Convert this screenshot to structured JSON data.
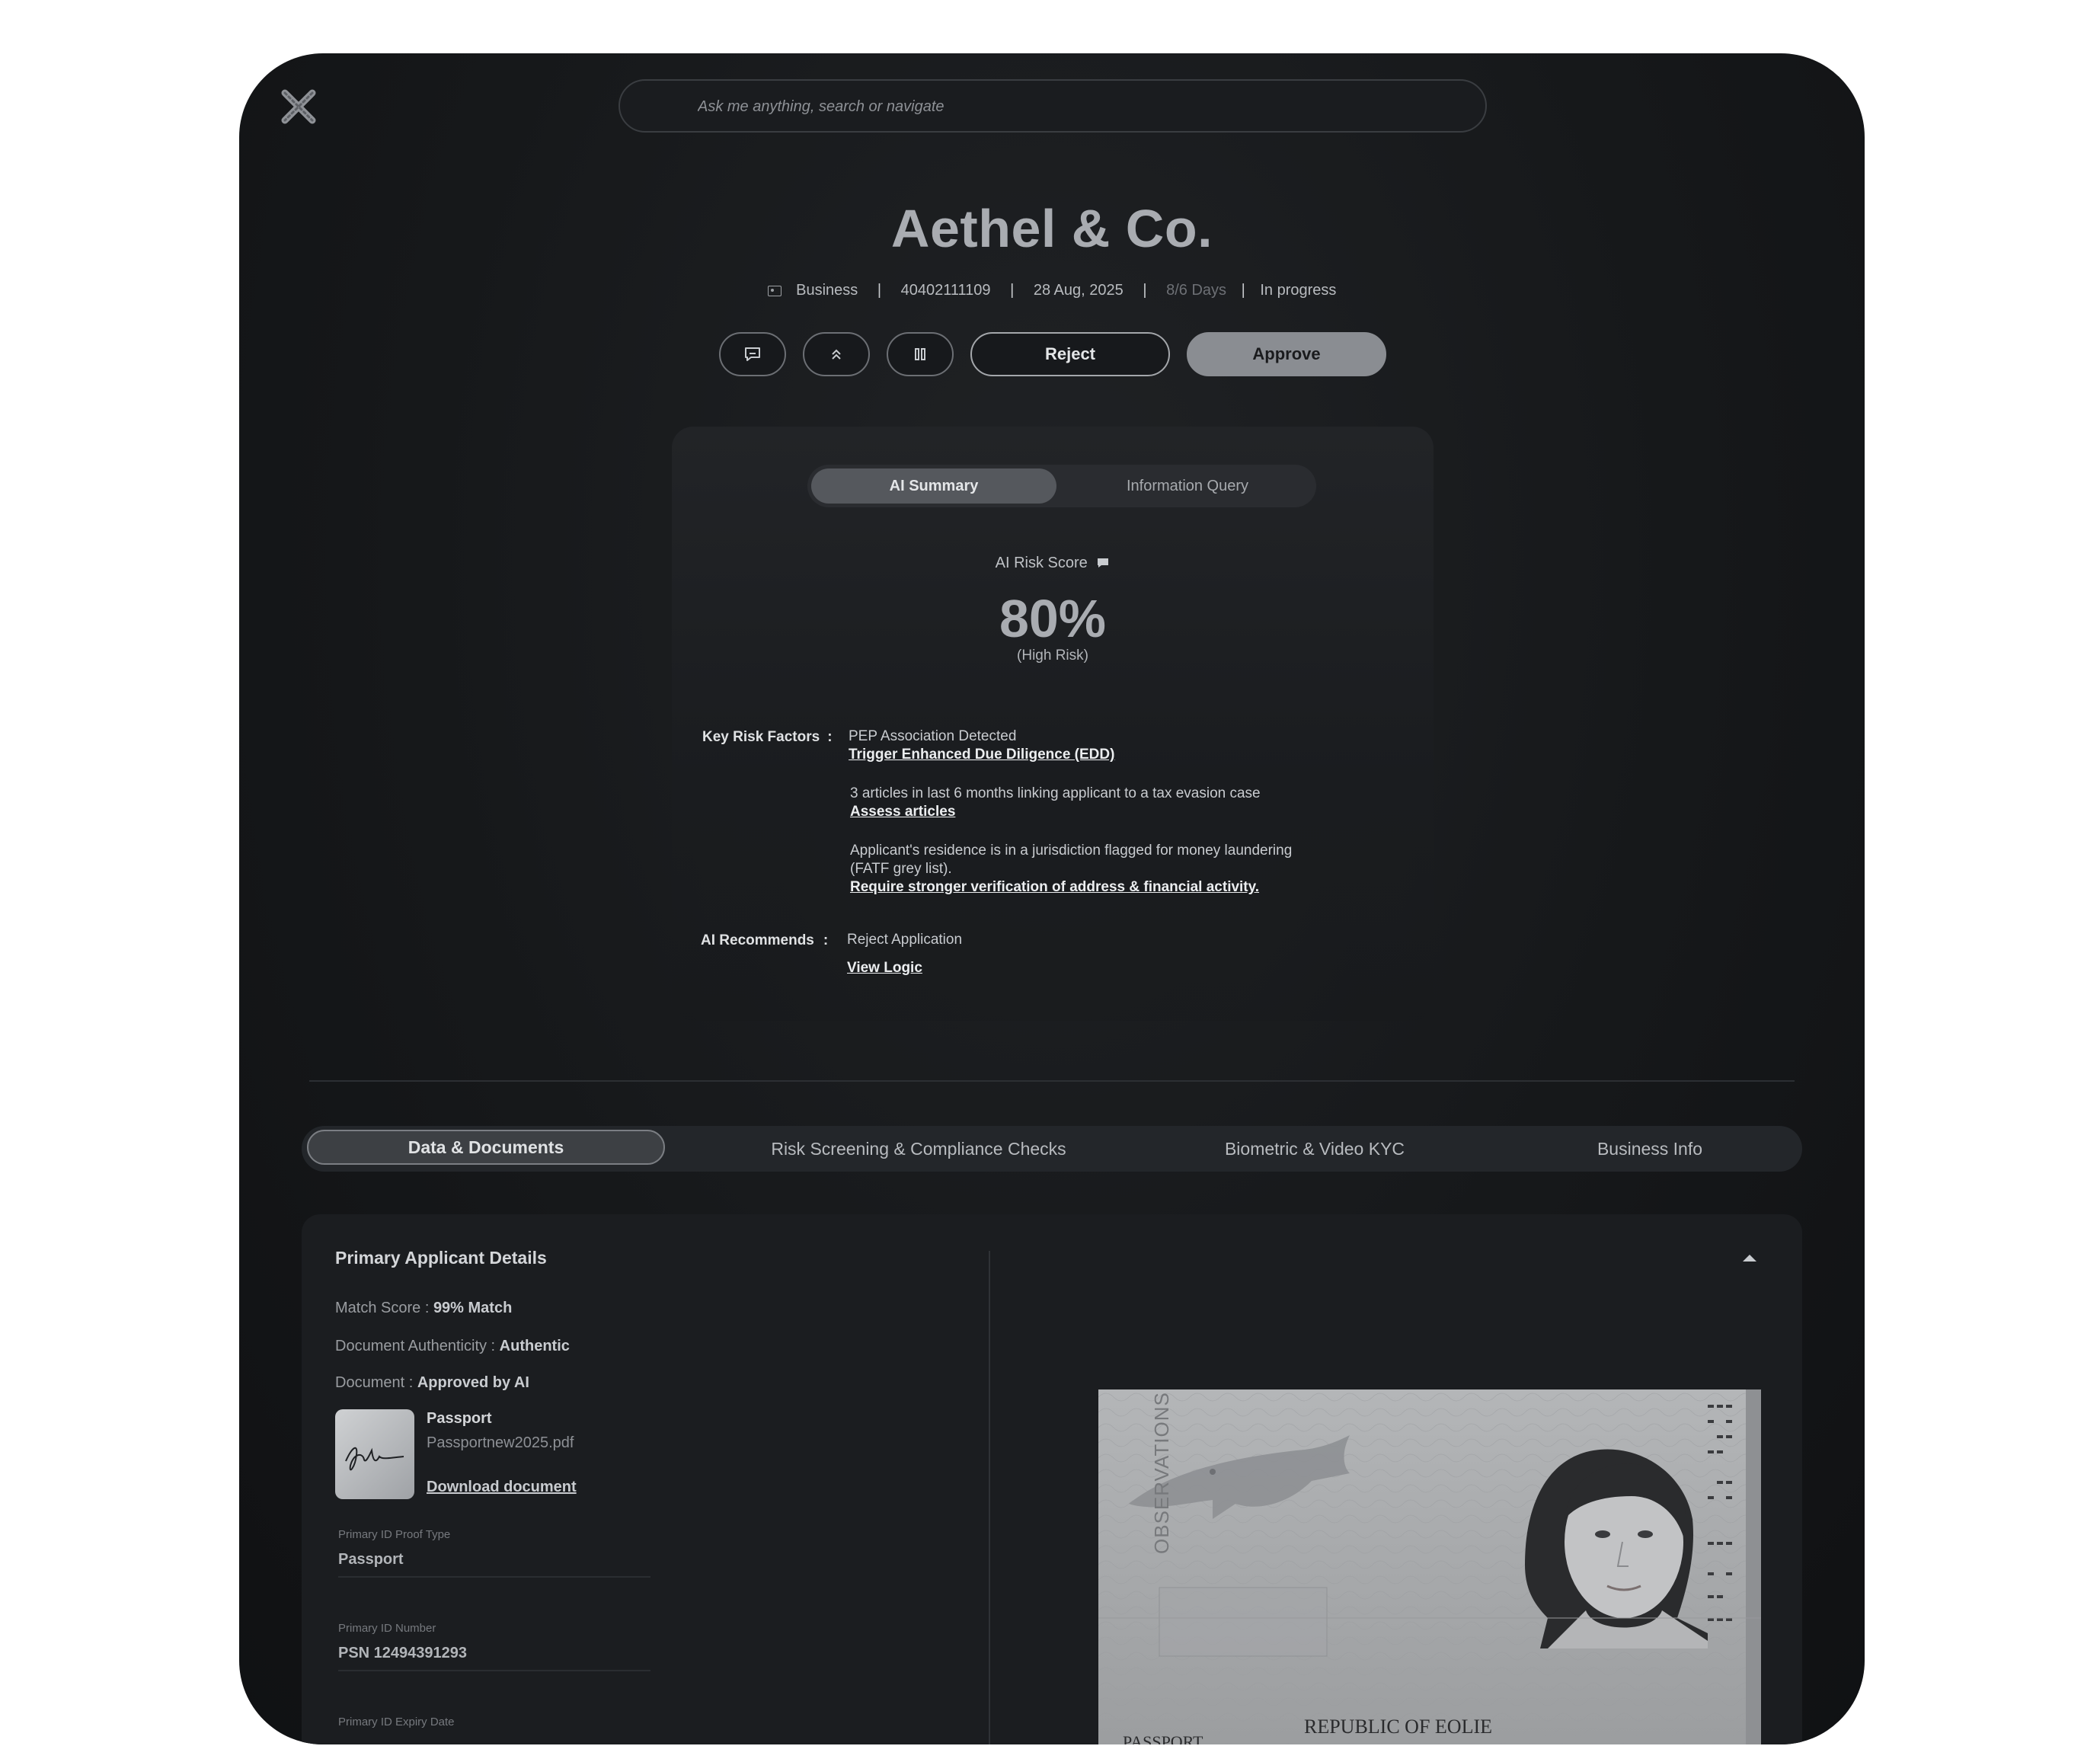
{
  "search": {
    "placeholder": "Ask me anything, search or navigate"
  },
  "header": {
    "title": "Aethel & Co.",
    "meta": {
      "type": "Business",
      "id": "40402111109",
      "date": "28 Aug, 2025",
      "days": "8/6 Days",
      "status": "In progress"
    },
    "actions": {
      "reject": "Reject",
      "approve": "Approve"
    }
  },
  "summary": {
    "tabs": [
      "AI Summary",
      "Information Query"
    ],
    "risk_label": "AI Risk Score",
    "risk_value": "80%",
    "risk_level": "(High Risk)",
    "key_risk_label": "Key Risk Factors",
    "factors": [
      {
        "text": "PEP Association Detected",
        "link": "Trigger Enhanced Due Diligence (EDD)"
      },
      {
        "text": "3 articles in last 6 months linking applicant to a tax evasion case",
        "link": "Assess articles"
      },
      {
        "text": "Applicant's residence is in a jurisdiction flagged for money laundering (FATF grey list).",
        "link": "Require stronger verification of address & financial activity."
      }
    ],
    "recommend_label": "AI Recommends",
    "recommend_value": "Reject Application",
    "recommend_link": "View Logic"
  },
  "tabs": [
    "Data & Documents",
    "Risk Screening & Compliance Checks",
    "Biometric & Video KYC",
    "Business Info"
  ],
  "applicant": {
    "heading": "Primary Applicant Details",
    "match_label": "Match Score",
    "match_value": "99% Match",
    "auth_label": "Document Authenticity",
    "auth_value": "Authentic",
    "doc_label": "Document",
    "doc_value": "Approved by AI",
    "doc_type": "Passport",
    "doc_file": "Passportnew2025.pdf",
    "download": "Download document",
    "fields": [
      {
        "label": "Primary ID Proof Type",
        "value": "Passport"
      },
      {
        "label": "Primary ID Number",
        "value": "PSN 12494391293"
      },
      {
        "label": "Primary ID Expiry Date",
        "value": ""
      }
    ]
  },
  "passport_image": {
    "vertical_text": "OBSERVATIONS",
    "country": "REPUBLIC OF EOLIE",
    "doc_word": "PASSPORT"
  }
}
